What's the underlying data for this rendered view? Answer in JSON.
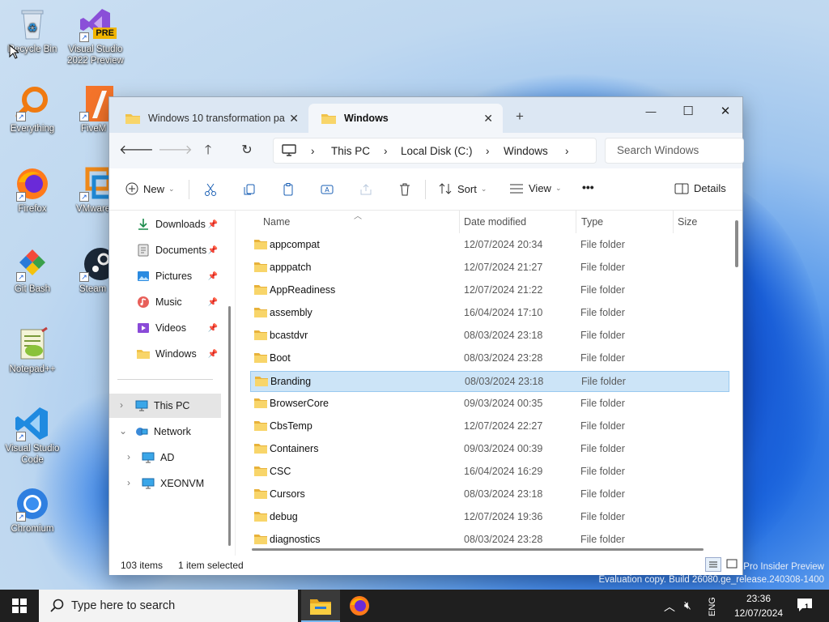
{
  "desktop": {
    "icons": [
      {
        "label": "Recycle Bin"
      },
      {
        "label": "Visual Studio 2022 Preview",
        "badge": "PRE"
      },
      {
        "label": "Everything"
      },
      {
        "label": "FiveM"
      },
      {
        "label": "Firefox"
      },
      {
        "label": "VMware Workstation"
      },
      {
        "label": "Git Bash"
      },
      {
        "label": "Steam"
      },
      {
        "label": "Notepad++"
      },
      {
        "label": "Visual Studio Code"
      },
      {
        "label": "Chromium"
      }
    ],
    "watermark_line1": "Pro Insider Preview",
    "watermark_line2": "Evaluation copy. Build 26080.ge_release.240308-1400"
  },
  "explorer": {
    "tabs": [
      {
        "label": "Windows 10 transformation pa",
        "close": "✕"
      },
      {
        "label": "Windows",
        "close": "✕"
      }
    ],
    "new_tab": "+",
    "window_controls": {
      "minimize": "—",
      "maximize": "☐",
      "close": "✕"
    },
    "breadcrumb": [
      "This PC",
      "Local Disk (C:)",
      "Windows"
    ],
    "search_placeholder": "Search Windows",
    "toolbar": {
      "new": "New",
      "sort": "Sort",
      "view": "View",
      "more": "•••",
      "details": "Details"
    },
    "sidebar": {
      "quick": [
        "Downloads",
        "Documents",
        "Pictures",
        "Music",
        "Videos",
        "Windows"
      ],
      "this_pc": "This PC",
      "network": "Network",
      "network_children": [
        "AD",
        "XEONVM"
      ]
    },
    "columns": {
      "name": "Name",
      "date": "Date modified",
      "type": "Type",
      "size": "Size"
    },
    "rows": [
      {
        "name": "appcompat",
        "date": "12/07/2024 20:34",
        "type": "File folder"
      },
      {
        "name": "apppatch",
        "date": "12/07/2024 21:27",
        "type": "File folder"
      },
      {
        "name": "AppReadiness",
        "date": "12/07/2024 21:22",
        "type": "File folder"
      },
      {
        "name": "assembly",
        "date": "16/04/2024 17:10",
        "type": "File folder"
      },
      {
        "name": "bcastdvr",
        "date": "08/03/2024 23:18",
        "type": "File folder"
      },
      {
        "name": "Boot",
        "date": "08/03/2024 23:28",
        "type": "File folder"
      },
      {
        "name": "Branding",
        "date": "08/03/2024 23:18",
        "type": "File folder"
      },
      {
        "name": "BrowserCore",
        "date": "09/03/2024 00:35",
        "type": "File folder"
      },
      {
        "name": "CbsTemp",
        "date": "12/07/2024 22:27",
        "type": "File folder"
      },
      {
        "name": "Containers",
        "date": "09/03/2024 00:39",
        "type": "File folder"
      },
      {
        "name": "CSC",
        "date": "16/04/2024 16:29",
        "type": "File folder"
      },
      {
        "name": "Cursors",
        "date": "08/03/2024 23:18",
        "type": "File folder"
      },
      {
        "name": "debug",
        "date": "12/07/2024 19:36",
        "type": "File folder"
      },
      {
        "name": "diagnostics",
        "date": "08/03/2024 23:28",
        "type": "File folder"
      }
    ],
    "status": {
      "count": "103 items",
      "selected": "1 item selected"
    }
  },
  "taskbar": {
    "search_placeholder": "Type here to search",
    "language": "ENG",
    "time": "23:36",
    "date": "12/07/2024",
    "notifications": "1"
  }
}
